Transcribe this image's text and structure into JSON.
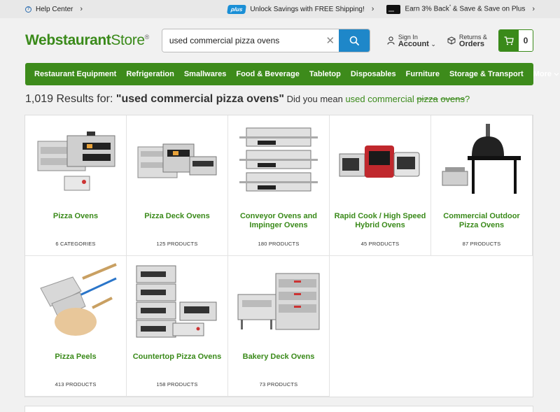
{
  "topbar": {
    "help_label": "Help Center",
    "plus_badge": "plus",
    "promo_shipping": "Unlock Savings with FREE Shipping!",
    "promo_card_pre": "Earn 3% Back",
    "promo_card_sup": "*",
    "promo_card_post": " & Save & Save on Plus"
  },
  "header": {
    "logo_main": "Webstaurant",
    "logo_store": "Store",
    "logo_reg": "®",
    "search_value": "used commercial pizza ovens",
    "account_small": "Sign In",
    "account_big": "Account",
    "orders_small": "Returns &",
    "orders_big": "Orders",
    "cart_count": "0"
  },
  "nav": {
    "items": [
      "Restaurant Equipment",
      "Refrigeration",
      "Smallwares",
      "Food & Beverage",
      "Tabletop",
      "Disposables",
      "Furniture",
      "Storage & Transport"
    ],
    "more_label": "More"
  },
  "results": {
    "count": "1,019",
    "results_for": " Results for: ",
    "query": "\"used commercial pizza ovens\"",
    "did_you_mean": " Did you mean ",
    "sugg_a": "used commercial ",
    "sugg_strike_1": "pizza",
    "sugg_space": " ",
    "sugg_strike_2": "ovens",
    "sugg_end": "?"
  },
  "categories": [
    {
      "name": "Pizza Ovens",
      "count": "6 CATEGORIES",
      "icon": "pizza-oven-image"
    },
    {
      "name": "Pizza Deck Ovens",
      "count": "125 PRODUCTS",
      "icon": "deck-oven-image"
    },
    {
      "name": "Conveyor Ovens and Impinger Ovens",
      "count": "180 PRODUCTS",
      "icon": "conveyor-oven-image"
    },
    {
      "name": "Rapid Cook / High Speed Hybrid Ovens",
      "count": "45 PRODUCTS",
      "icon": "rapid-cook-oven-image"
    },
    {
      "name": "Commercial Outdoor Pizza Ovens",
      "count": "87 PRODUCTS",
      "icon": "outdoor-oven-image"
    },
    {
      "name": "Pizza Peels",
      "count": "413 PRODUCTS",
      "icon": "pizza-peel-image"
    },
    {
      "name": "Countertop Pizza Ovens",
      "count": "158 PRODUCTS",
      "icon": "countertop-oven-image"
    },
    {
      "name": "Bakery Deck Ovens",
      "count": "73 PRODUCTS",
      "icon": "bakery-oven-image"
    }
  ],
  "colors": {
    "brand_green": "#3d8b1b",
    "search_blue": "#1e87c9",
    "plus_blue": "#1a8fd6"
  }
}
